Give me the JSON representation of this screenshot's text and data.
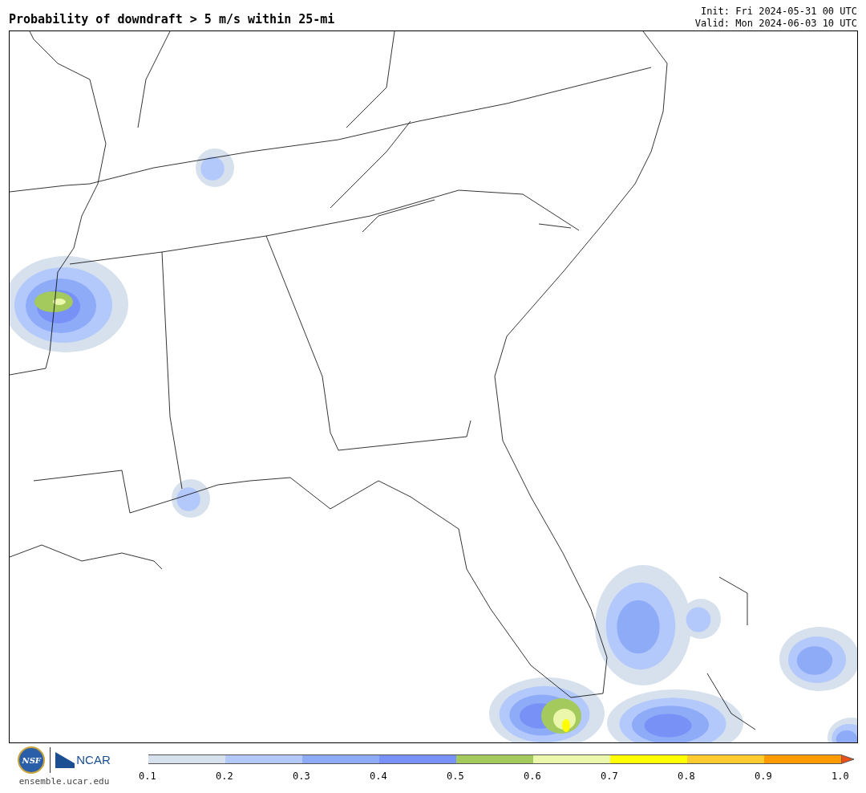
{
  "title": "Probability of downdraft > 5 m/s within 25-mi",
  "init": "Init: Fri 2024-05-31 00 UTC",
  "valid": "Valid: Mon 2024-06-03 10 UTC",
  "footer": {
    "nsf_text": "NSF",
    "ncar_text": "NCAR",
    "url": "ensemble.ucar.edu"
  },
  "colorbar": {
    "bins": [
      {
        "kind": "bin",
        "color": "#d6e1ed"
      },
      {
        "kind": "bin",
        "color": "#b3c8fb"
      },
      {
        "kind": "bin",
        "color": "#8eabf8"
      },
      {
        "kind": "bin",
        "color": "#7891f6"
      },
      {
        "kind": "bin",
        "color": "#a4c95c"
      },
      {
        "kind": "bin",
        "color": "#ebf7ab"
      },
      {
        "kind": "bin",
        "color": "#ffff00"
      },
      {
        "kind": "bin",
        "color": "#ffcb2f"
      },
      {
        "kind": "bin",
        "color": "#ff9b00"
      },
      {
        "kind": "arrow",
        "color": "#e8501c"
      }
    ],
    "ticks": [
      "0.1",
      "0.2",
      "0.3",
      "0.4",
      "0.5",
      "0.6",
      "0.7",
      "0.8",
      "0.9",
      "1.0"
    ]
  }
}
